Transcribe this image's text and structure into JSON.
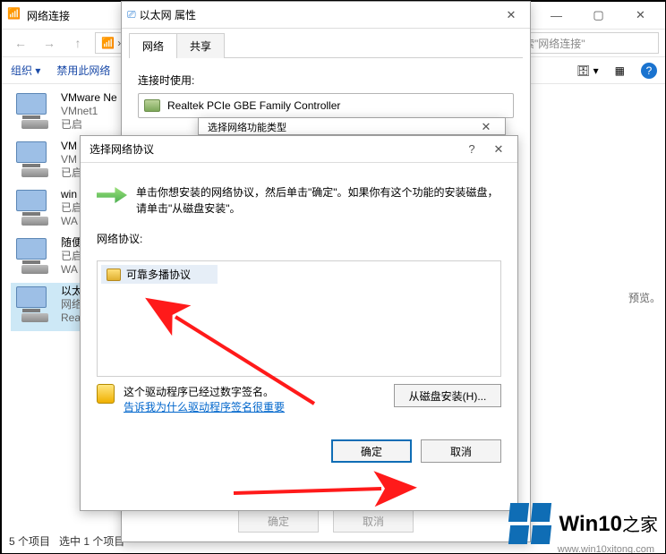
{
  "explorer": {
    "title": "网络连接",
    "search_placeholder": "搜索\"网络连接\"",
    "cmd_organize": "组织 ▾",
    "cmd_disable": "禁用此网络",
    "preview_hint": "预览。",
    "status_count": "5 个项目",
    "status_selected": "选中 1 个项目",
    "items": [
      {
        "name": "VMware Ne",
        "line2": "VMnet1",
        "line3": "已启"
      },
      {
        "name": "VM",
        "line2": "VM",
        "line3": "已启"
      },
      {
        "name": "win",
        "line2": "已启",
        "line3": "WA"
      },
      {
        "name": "随便",
        "line2": "已启",
        "line3": "WA"
      },
      {
        "name": "以太",
        "line2": "网络",
        "line3": "Rea"
      }
    ]
  },
  "ethprops": {
    "title": "以太网 属性",
    "tab_network": "网络",
    "tab_share": "共享",
    "label_connect_using": "连接时使用:",
    "device_name": "Realtek PCIe GBE Family Controller",
    "btn_ok": "确定",
    "btn_cancel": "取消"
  },
  "seltype": {
    "title": "选择网络功能类型"
  },
  "selproto": {
    "title": "选择网络协议",
    "help_glyph": "?",
    "close_glyph": "✕",
    "intro_text": "单击你想安装的网络协议，然后单击\"确定\"。如果你有这个功能的安装磁盘，请单击\"从磁盘安装\"。",
    "group_label": "网络协议:",
    "protocol_item": "可靠多播协议",
    "signed_text": "这个驱动程序已经过数字签名。",
    "why_link": "告诉我为什么驱动程序签名很重要",
    "btn_disk": "从磁盘安装(H)...",
    "btn_ok": "确定",
    "btn_cancel": "取消"
  },
  "logo": {
    "text_main": "Win10",
    "text_sub": "之家",
    "url": "www.win10xitong.com"
  }
}
